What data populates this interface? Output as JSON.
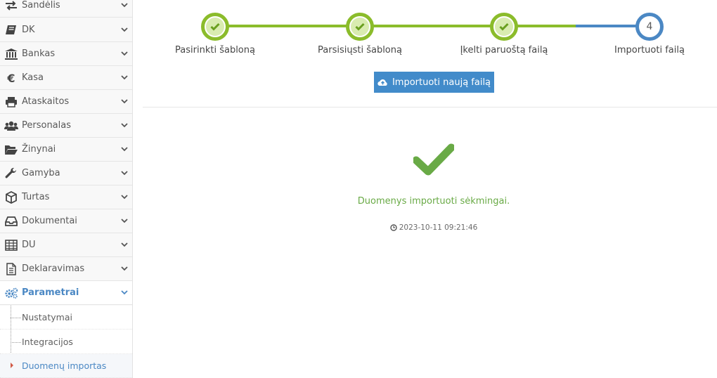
{
  "sidebar": {
    "items": [
      {
        "label": "Sandėlis",
        "icon": "exchange-icon"
      },
      {
        "label": "DK",
        "icon": "book-icon"
      },
      {
        "label": "Bankas",
        "icon": "bank-icon"
      },
      {
        "label": "Kasa",
        "icon": "euro-icon"
      },
      {
        "label": "Ataskaitos",
        "icon": "print-icon"
      },
      {
        "label": "Personalas",
        "icon": "users-icon"
      },
      {
        "label": "Žinynai",
        "icon": "folder-open-icon"
      },
      {
        "label": "Gamyba",
        "icon": "wrench-icon"
      },
      {
        "label": "Turtas",
        "icon": "cube-icon"
      },
      {
        "label": "Dokumentai",
        "icon": "inbox-icon"
      },
      {
        "label": "DU",
        "icon": "table-icon"
      },
      {
        "label": "Deklaravimas",
        "icon": "file-text-icon"
      },
      {
        "label": "Parametrai",
        "icon": "cogs-icon",
        "active": true
      }
    ],
    "subitems": [
      {
        "label": "Nustatymai"
      },
      {
        "label": "Integracijos"
      },
      {
        "label": "Duomenų importas",
        "active": true
      }
    ]
  },
  "wizard": {
    "steps": [
      {
        "label": "Pasirinkti šabloną",
        "status": "done"
      },
      {
        "label": "Parsisiųsti šabloną",
        "status": "done"
      },
      {
        "label": "Įkelti paruoštą failą",
        "status": "done"
      },
      {
        "label": "Importuoti failą",
        "status": "pending",
        "number": "4"
      }
    ]
  },
  "actions": {
    "import_new_label": "Importuoti naują failą"
  },
  "result": {
    "message": "Duomenys importuoti sėkmingai.",
    "timestamp": "2023-10-11 09:21:46"
  },
  "colors": {
    "accent_blue": "#428bca",
    "success_green": "#69aa46",
    "step_green": "#8bbc2b",
    "active_blue": "#4b88c4"
  }
}
